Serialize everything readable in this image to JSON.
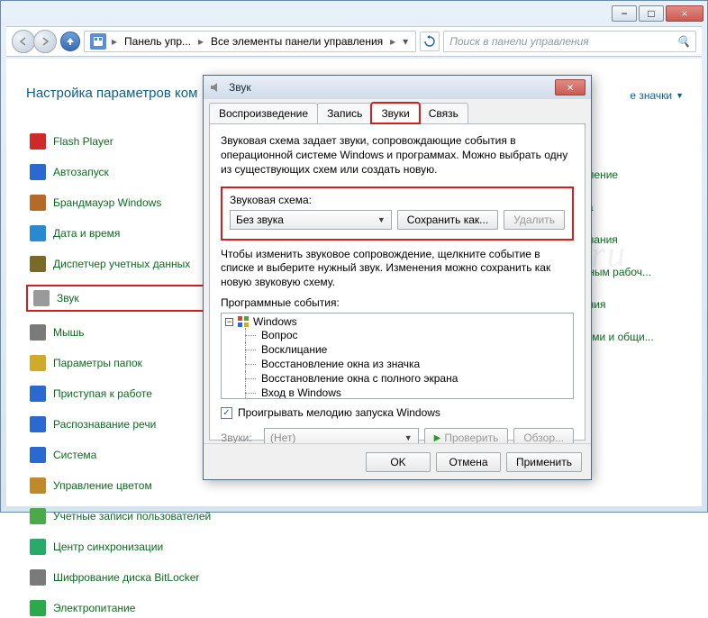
{
  "window": {
    "minimize_icon": "−",
    "maximize_icon": "□",
    "close_icon": "×"
  },
  "nav": {
    "breadcrumb": [
      "Панель упр...",
      "Все элементы панели управления"
    ],
    "search_placeholder": "Поиск в панели управления"
  },
  "page": {
    "title": "Настройка параметров ком",
    "view_link": "е значки"
  },
  "cp_items": [
    {
      "label": "Flash Player",
      "color": "#ce2a2a"
    },
    {
      "label": "Автозапуск",
      "color": "#2a6ad0"
    },
    {
      "label": "Брандмауэр Windows",
      "color": "#b56a2a"
    },
    {
      "label": "Дата и время",
      "color": "#2a8ad0"
    },
    {
      "label": "Диспетчер учетных данных",
      "color": "#7a6a2a"
    },
    {
      "label": "Звук",
      "color": "#9a9a9a",
      "highlight": true
    },
    {
      "label": "Мышь",
      "color": "#7a7a7a"
    },
    {
      "label": "Параметры папок",
      "color": "#d0aa2a"
    },
    {
      "label": "Приступая к работе",
      "color": "#2a6ad0"
    },
    {
      "label": "Распознавание речи",
      "color": "#2a6ad0"
    },
    {
      "label": "Система",
      "color": "#2a6ad0"
    },
    {
      "label": "Управление цветом",
      "color": "#c08a2a"
    },
    {
      "label": "Учетные записи пользователей",
      "color": "#4aaa4a"
    },
    {
      "label": "Центр синхронизации",
      "color": "#2aaa6a"
    },
    {
      "label": "Шифрование диска BitLocker",
      "color": "#7a7a7a"
    },
    {
      "label": "Электропитание",
      "color": "#2aaa4a"
    }
  ],
  "right_items": [
    "новление",
    "тола",
    "ирования",
    "ленным рабоч...",
    "лчания",
    "сетями и общи..."
  ],
  "dialog": {
    "title": "Звук",
    "tabs": [
      "Воспроизведение",
      "Запись",
      "Звуки",
      "Связь"
    ],
    "active_tab": 2,
    "description": "Звуковая схема задает звуки, сопровождающие события в операционной системе Windows и программах. Можно выбрать одну из существующих схем или создать новую.",
    "scheme_label": "Звуковая схема:",
    "scheme_value": "Без звука",
    "save_as": "Сохранить как...",
    "delete": "Удалить",
    "hint": "Чтобы изменить звуковое сопровождение, щелкните событие в списке и выберите нужный звук. Изменения можно сохранить как новую звуковую схему.",
    "events_label": "Программные события:",
    "tree_root": "Windows",
    "tree_items": [
      "Вопрос",
      "Восклицание",
      "Восстановление окна из значка",
      "Восстановление окна с полного экрана",
      "Вход в Windows"
    ],
    "play_startup": "Проигрывать мелодию запуска Windows",
    "sounds_label": "Звуки:",
    "sounds_value": "(Нет)",
    "test_btn": "Проверить",
    "browse_btn": "Обзор...",
    "ok": "OK",
    "cancel": "Отмена",
    "apply": "Применить"
  },
  "watermark": "All4os.ru"
}
